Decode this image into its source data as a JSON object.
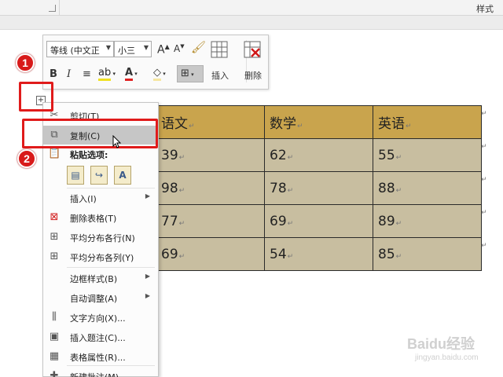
{
  "ribbon": {
    "styles_label": "样式"
  },
  "toolbar": {
    "font_name": "等线 (中文正",
    "font_size": "小三",
    "grow_font": "A",
    "shrink_font": "A",
    "bold": "B",
    "italic": "I",
    "font_color_glyph": "A",
    "insert_label": "插入",
    "delete_label": "删除"
  },
  "table": {
    "headers": [
      "语文",
      "数学",
      "英语"
    ],
    "rows": [
      [
        "39",
        "62",
        "55"
      ],
      [
        "98",
        "78",
        "88"
      ],
      [
        "77",
        "69",
        "89"
      ],
      [
        "69",
        "54",
        "85"
      ]
    ],
    "para_mark": "↵"
  },
  "context_menu": {
    "items": [
      {
        "label": "剪切(T)",
        "icon": "scissors-icon"
      },
      {
        "label": "复制(C)",
        "icon": "copy-icon"
      },
      {
        "label": "粘贴选项:",
        "icon": "paste-icon"
      },
      {
        "label": "插入(I)",
        "icon": ""
      },
      {
        "label": "删除表格(T)",
        "icon": "delete-table-icon"
      },
      {
        "label": "平均分布各行(N)",
        "icon": "distribute-rows-icon"
      },
      {
        "label": "平均分布各列(Y)",
        "icon": "distribute-columns-icon"
      },
      {
        "label": "边框样式(B)",
        "icon": ""
      },
      {
        "label": "自动调整(A)",
        "icon": ""
      },
      {
        "label": "文字方向(X)...",
        "icon": "text-direction-icon"
      },
      {
        "label": "插入题注(C)...",
        "icon": "insert-caption-icon"
      },
      {
        "label": "表格属性(R)...",
        "icon": "table-properties-icon"
      },
      {
        "label": "新建批注(M)",
        "icon": "new-comment-icon"
      }
    ]
  },
  "annotations": {
    "step1": "1",
    "step2": "2"
  },
  "watermark": {
    "brand": "Baidu经验",
    "url": "jingyan.baidu.com"
  },
  "colors": {
    "header_fill": "#c9a44d",
    "body_fill": "#c8bea0",
    "highlight": "#c6c6c6",
    "annotation_red": "#e01b1b"
  }
}
